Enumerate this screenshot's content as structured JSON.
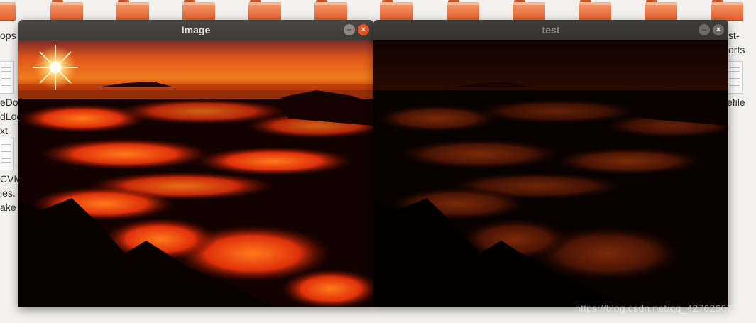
{
  "desktop": {
    "labels": {
      "left_top": "ops",
      "left_mid": "eDo\ndLog\nxt",
      "left_bot": "CVM\nles.\nake",
      "right_top": "st-\norts",
      "right_mid": "efile"
    }
  },
  "windows": [
    {
      "title": "Image",
      "state": "active"
    },
    {
      "title": "test",
      "state": "inactive"
    }
  ],
  "controls": {
    "minimize": "–",
    "close": "×"
  },
  "watermark": "https://blog.csdn.net/qq_42762607",
  "colors": {
    "accent_close": "#e95420",
    "titlebar": "#3c3b37"
  }
}
